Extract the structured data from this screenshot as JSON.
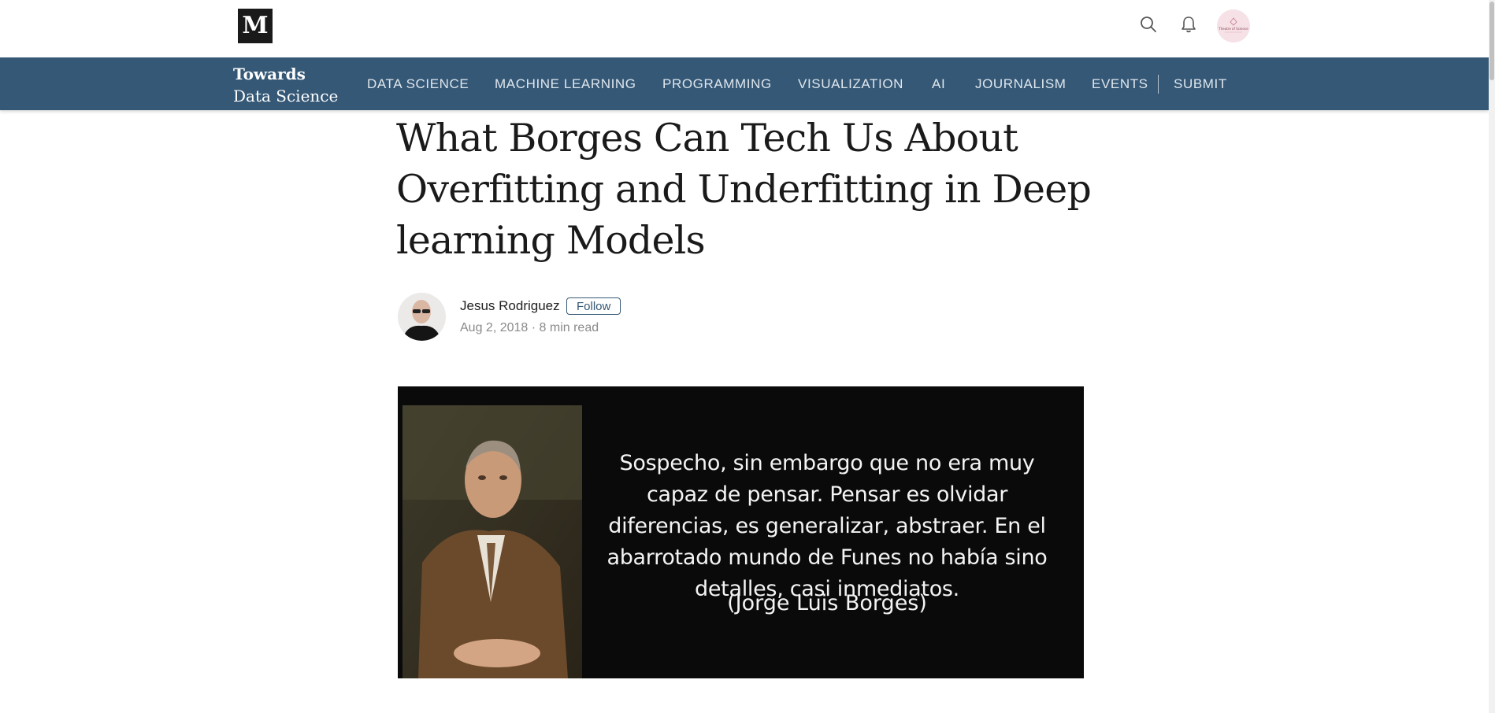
{
  "header": {
    "logo_letter": "M",
    "avatar_text": "Theatre of Science"
  },
  "publication": {
    "name_line1": "Towards",
    "name_line2": "Data Science"
  },
  "nav": {
    "items": [
      "DATA SCIENCE",
      "MACHINE LEARNING",
      "PROGRAMMING",
      "VISUALIZATION",
      "AI",
      "JOURNALISM",
      "EVENTS",
      "SUBMIT"
    ]
  },
  "article": {
    "title": "What Borges Can Tech Us About Overfitting and Underfitting in Deep learning Models",
    "author": "Jesus Rodriguez",
    "follow_label": "Follow",
    "date": "Aug 2, 2018",
    "separator": "·",
    "read_time": "8 min read",
    "hero": {
      "quote": "Sospecho, sin embargo que no era muy capaz de pensar. Pensar es olvidar diferencias, es generalizar, abstraer. En el abarrotado mundo de Funes no había sino detalles, casi inmediatos.",
      "quote_author": "(Jorge Luis Borges)"
    }
  },
  "colors": {
    "nav_background": "#355876",
    "logo_background": "#1a1a1a",
    "hero_background": "#0a0a0a"
  },
  "icons": [
    "search-icon",
    "bell-icon",
    "user-avatar"
  ]
}
